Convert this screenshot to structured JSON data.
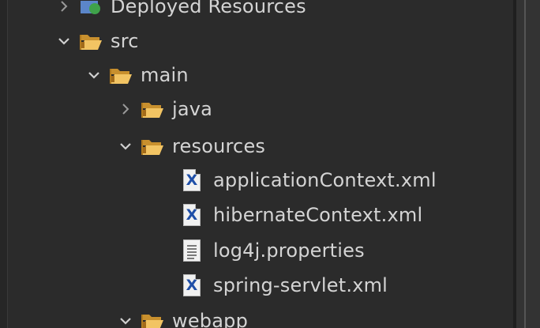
{
  "tree": {
    "items": [
      {
        "label": "Deployed Resources",
        "state": "collapsed",
        "icon": "deployed-resources-icon"
      },
      {
        "label": "src",
        "state": "expanded",
        "icon": "folder-icon"
      },
      {
        "label": "main",
        "state": "expanded",
        "icon": "folder-icon"
      },
      {
        "label": "java",
        "state": "collapsed",
        "icon": "folder-icon"
      },
      {
        "label": "resources",
        "state": "expanded",
        "icon": "folder-icon"
      },
      {
        "label": "applicationContext.xml",
        "icon": "xml-file-icon"
      },
      {
        "label": "hibernateContext.xml",
        "icon": "xml-file-icon"
      },
      {
        "label": "log4j.properties",
        "icon": "text-file-icon"
      },
      {
        "label": "spring-servlet.xml",
        "icon": "xml-file-icon"
      },
      {
        "label": "webapp",
        "state": "expanded",
        "icon": "folder-icon"
      }
    ],
    "xml_glyph": "X"
  },
  "colors": {
    "background": "#2b2b2b",
    "text": "#d4d4d4",
    "folder": "#e8b24a",
    "xml_badge": "#1f4fa8"
  }
}
